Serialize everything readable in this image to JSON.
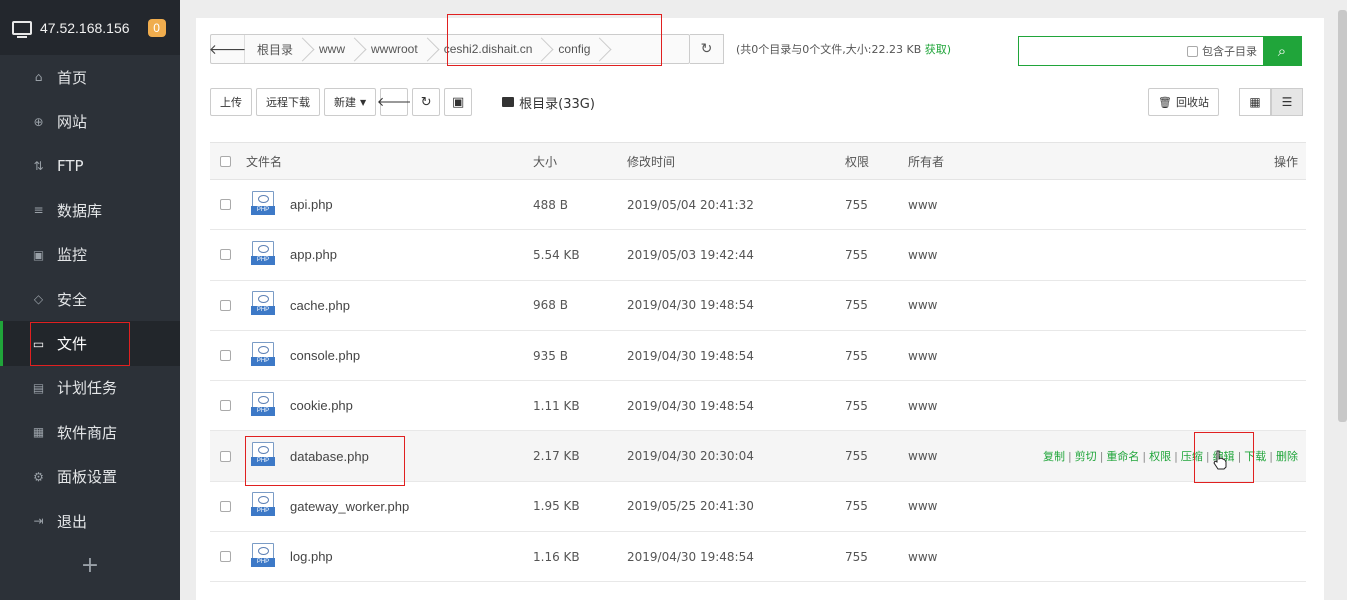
{
  "sidebar": {
    "ip": "47.52.168.156",
    "badge": "0",
    "items": [
      {
        "label": "首页",
        "icon": "home-icon",
        "glyph": "⌂"
      },
      {
        "label": "网站",
        "icon": "globe-icon",
        "glyph": "⊕"
      },
      {
        "label": "FTP",
        "icon": "ftp-icon",
        "glyph": "⇅"
      },
      {
        "label": "数据库",
        "icon": "database-icon",
        "glyph": "≡"
      },
      {
        "label": "监控",
        "icon": "monitor-icon",
        "glyph": "▣"
      },
      {
        "label": "安全",
        "icon": "shield-icon",
        "glyph": "◇"
      },
      {
        "label": "文件",
        "icon": "folder-icon",
        "glyph": "▭"
      },
      {
        "label": "计划任务",
        "icon": "calendar-icon",
        "glyph": "▤"
      },
      {
        "label": "软件商店",
        "icon": "apps-icon",
        "glyph": "▦"
      },
      {
        "label": "面板设置",
        "icon": "gear-icon",
        "glyph": "⚙"
      },
      {
        "label": "退出",
        "icon": "logout-icon",
        "glyph": "⇥"
      }
    ],
    "active_index": 6,
    "add": "+"
  },
  "path": {
    "crumbs": [
      "根目录",
      "www",
      "wwwroot",
      "ceshi2.dishait.cn",
      "config"
    ],
    "summary": "(共0个目录与0个文件,大小:",
    "size": "22.23 KB",
    "get": "获取)"
  },
  "search": {
    "include_sub": "包含子目录"
  },
  "toolbar": {
    "upload": "上传",
    "remote_download": "远程下载",
    "new": "新建",
    "disk": "根目录(33G)",
    "recycle": "回收站"
  },
  "table": {
    "headers": {
      "name": "文件名",
      "size": "大小",
      "time": "修改时间",
      "perm": "权限",
      "owner": "所有者",
      "ops": "操作"
    },
    "rows": [
      {
        "name": "api.php",
        "size": "488 B",
        "time": "2019/05/04 20:41:32",
        "perm": "755",
        "owner": "www"
      },
      {
        "name": "app.php",
        "size": "5.54 KB",
        "time": "2019/05/03 19:42:44",
        "perm": "755",
        "owner": "www"
      },
      {
        "name": "cache.php",
        "size": "968 B",
        "time": "2019/04/30 19:48:54",
        "perm": "755",
        "owner": "www"
      },
      {
        "name": "console.php",
        "size": "935 B",
        "time": "2019/04/30 19:48:54",
        "perm": "755",
        "owner": "www"
      },
      {
        "name": "cookie.php",
        "size": "1.11 KB",
        "time": "2019/04/30 19:48:54",
        "perm": "755",
        "owner": "www"
      },
      {
        "name": "database.php",
        "size": "2.17 KB",
        "time": "2019/04/30 20:30:04",
        "perm": "755",
        "owner": "www"
      },
      {
        "name": "gateway_worker.php",
        "size": "1.95 KB",
        "time": "2019/05/25 20:41:30",
        "perm": "755",
        "owner": "www"
      },
      {
        "name": "log.php",
        "size": "1.16 KB",
        "time": "2019/04/30 19:48:54",
        "perm": "755",
        "owner": "www"
      }
    ],
    "hover_index": 5,
    "ops": [
      "复制",
      "剪切",
      "重命名",
      "权限",
      "压缩",
      "编辑",
      "下载",
      "删除"
    ],
    "file_icon_label": "PHP"
  },
  "colors": {
    "accent": "#20a53a",
    "sidebar": "#2c3138",
    "highlight": "#e02020"
  }
}
